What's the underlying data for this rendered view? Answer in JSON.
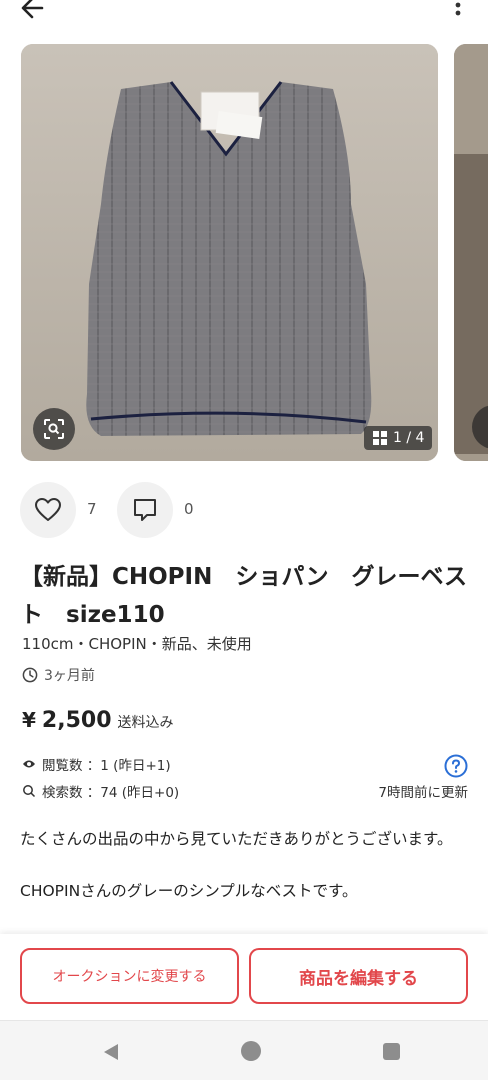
{
  "header": {
    "back_icon": "arrow-left-icon",
    "more_icon": "more-vertical-icon"
  },
  "gallery": {
    "counter": "1 / 4",
    "lens_icon": "image-search-icon",
    "grid_icon": "grid-icon"
  },
  "actions": {
    "like_count": "7",
    "comment_count": "0"
  },
  "item": {
    "title": "【新品】CHOPIN　ショパン　グレーベスト　size110",
    "meta": "110cm・CHOPIN・新品、未使用",
    "posted": "3ヶ月前",
    "price_symbol": "¥",
    "price": "2,500",
    "shipping_note": "送料込み"
  },
  "stats": {
    "views": "閲覧数 ：1 (昨日+1)",
    "searches": "検索数 ：74 (昨日+0)",
    "updated": "7時間前に更新"
  },
  "description": {
    "para1": "たくさんの出品の中から見ていただきありがとうございます。",
    "para2": "CHOPINさんのグレーのシンプルなベストです。"
  },
  "buttons": {
    "auction": "オークションに変更する",
    "edit": "商品を編集する"
  },
  "colors": {
    "accent": "#e2474b",
    "vest_gray": "#7b7b7d",
    "trim_navy": "#1c2140"
  }
}
